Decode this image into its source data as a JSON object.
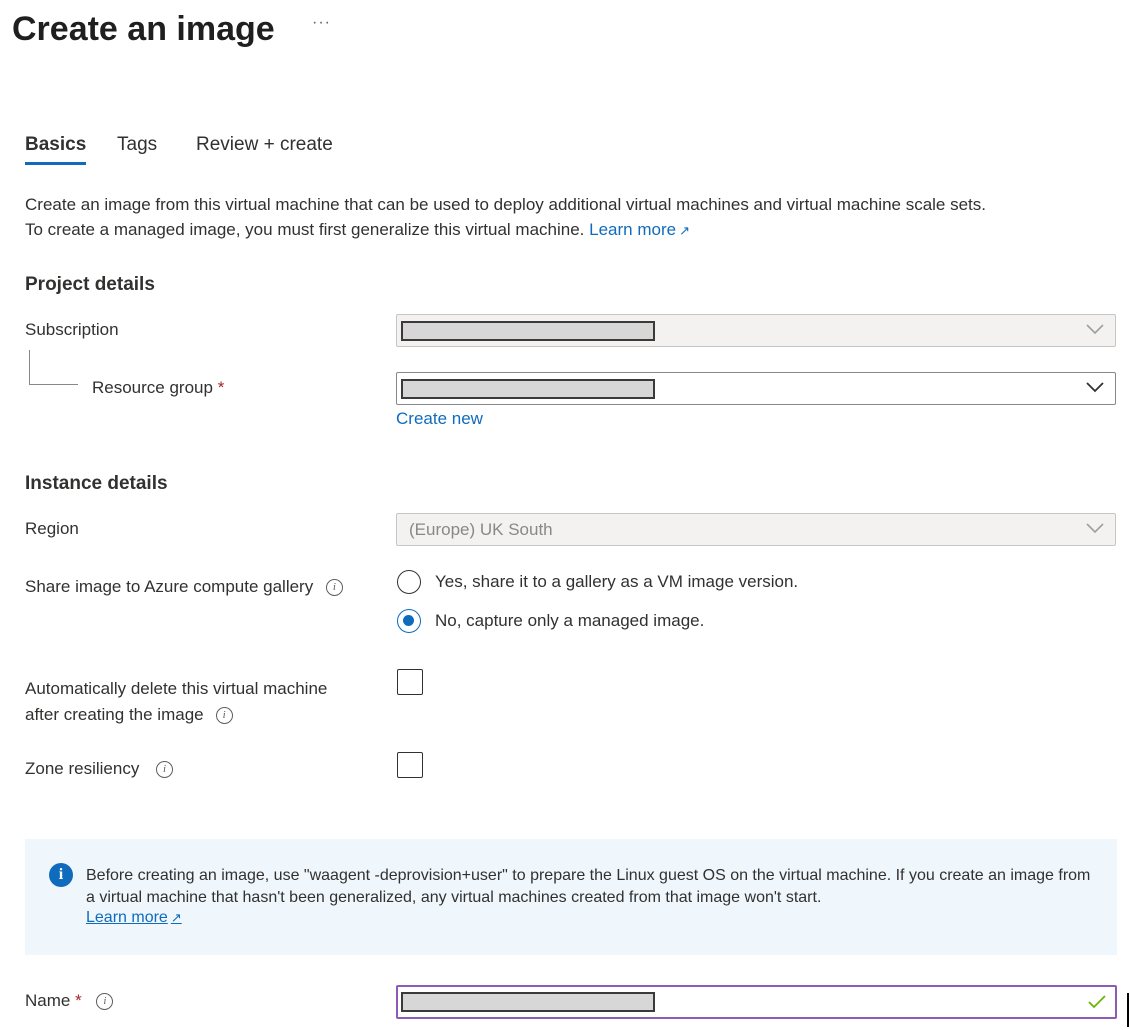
{
  "page": {
    "title": "Create an image",
    "more_label": "···"
  },
  "tabs": [
    {
      "label": "Basics",
      "active": true
    },
    {
      "label": "Tags",
      "active": false
    },
    {
      "label": "Review + create",
      "active": false
    }
  ],
  "description": {
    "line1": "Create an image from this virtual machine that can be used to deploy additional virtual machines and virtual machine scale sets.",
    "line2": "To create a managed image, you must first generalize this virtual machine.",
    "learn_more": "Learn more"
  },
  "project_details": {
    "heading": "Project details",
    "subscription_label": "Subscription",
    "resource_group_label": "Resource group",
    "required_mark": "*",
    "create_new": "Create new"
  },
  "instance_details": {
    "heading": "Instance details",
    "region_label": "Region",
    "region_value": "(Europe) UK South",
    "share_label": "Share image to Azure compute gallery",
    "share_options": [
      {
        "label": "Yes, share it to a gallery as a VM image version.",
        "selected": false
      },
      {
        "label": "No, capture only a managed image.",
        "selected": true
      }
    ],
    "auto_delete_label_line1": "Automatically delete this virtual machine",
    "auto_delete_label_line2": "after creating the image",
    "auto_delete_checked": false,
    "zone_label": "Zone resiliency",
    "zone_checked": false
  },
  "banner": {
    "icon": "info-icon",
    "text": "Before creating an image, use \"waagent -deprovision+user\" to prepare the Linux guest OS on the virtual machine. If you create an image from a virtual machine that hasn't been generalized, any virtual machines created from that image won't start.",
    "learn_more": "Learn more"
  },
  "name_field": {
    "label": "Name",
    "required_mark": "*",
    "valid": true
  },
  "colors": {
    "accent": "#0f6cbd",
    "required": "#a4262c",
    "banner_bg": "#eff6fc",
    "focus_border": "#8d5bb5",
    "valid_check": "#6bb700"
  }
}
